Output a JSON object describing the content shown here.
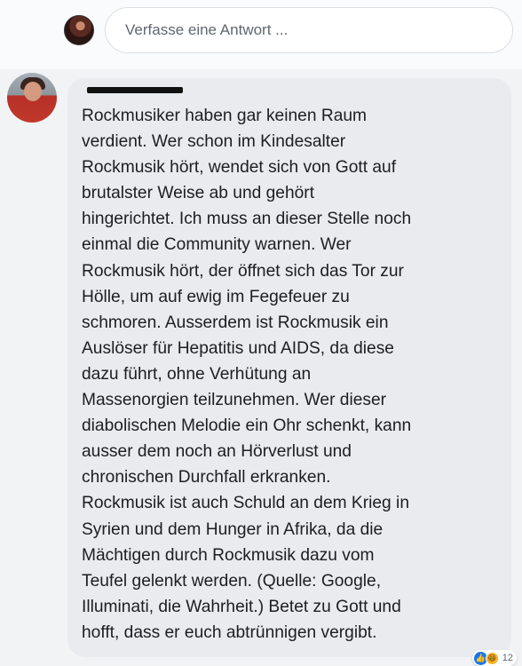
{
  "reply": {
    "placeholder": "Verfasse eine Antwort ..."
  },
  "comment": {
    "text": "Rockmusiker haben gar keinen Raum\nverdient. Wer schon im Kindesalter\nRockmusik hört, wendet sich von Gott auf\nbrutalster Weise ab und gehört\nhingerichtet. Ich muss an dieser Stelle noch\neinmal die Community warnen. Wer\nRockmusik hört, der öffnet sich das Tor zur\nHölle, um auf ewig im Fegefeuer zu\nschmoren. Ausserdem ist Rockmusik ein\nAuslöser für Hepatitis und AIDS, da diese\ndazu führt, ohne Verhütung an\nMassenorgien teilzunehmen. Wer dieser\ndiabolischen Melodie ein Ohr schenkt, kann\nausser dem noch an Hörverlust und\nchronischen Durchfall erkranken.\nRockmusik ist auch Schuld an dem Krieg in\nSyrien und dem Hunger in Afrika, da die\nMächtigen durch Rockmusik dazu vom\nTeufel gelenkt werden. (Quelle: Google,\nIlluminati, die Wahrheit.) Betet zu Gott und\nhofft, dass er euch abtrünnigen vergibt.",
    "reactions": {
      "icons": [
        "like-icon",
        "haha-icon"
      ],
      "count": "12"
    }
  },
  "colors": {
    "bubble": "#e9ebee",
    "background": "#f2f3f5",
    "like": "#1877f2",
    "haha": "#f7b125"
  }
}
